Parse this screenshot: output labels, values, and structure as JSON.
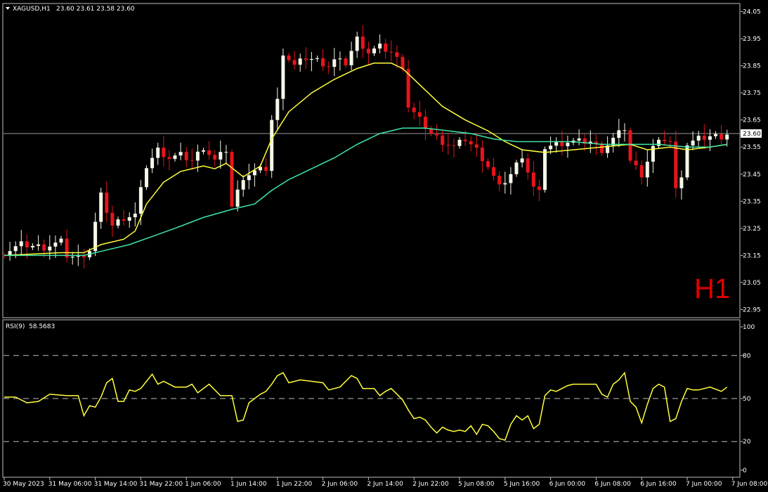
{
  "header": {
    "symbol_label": "XAGUSD,H1",
    "ohlc": "23.60 23.61 23.58 23.60"
  },
  "timeframe_badge": "H1",
  "rsi_header": {
    "label": "RSI(9)",
    "value": "58.5683"
  },
  "colors": {
    "background": "#000000",
    "frame": "#c0c0c0",
    "bull_candle": "#f4f8e8",
    "bear_candle": "#e8141c",
    "ma_fast": "#ffff3c",
    "ma_slow": "#3ee8a8",
    "rsi_line": "#ffff3c",
    "text": "#ffffff",
    "badge": "#e00000"
  },
  "chart_data": [
    {
      "type": "candlestick",
      "title": "XAGUSD,H1",
      "price_axis": {
        "range": [
          22.92,
          24.08
        ],
        "ticks": [
          "24.05",
          "23.95",
          "23.85",
          "23.75",
          "23.65",
          "23.55",
          "23.45",
          "23.35",
          "23.25",
          "23.15",
          "23.05",
          "22.95"
        ]
      },
      "current_price": "23.60",
      "time_axis": {
        "labels": [
          "30 May 2023",
          "31 May 06:00",
          "31 May 14:00",
          "31 May 22:00",
          "1 Jun 06:00",
          "1 Jun 14:00",
          "1 Jun 22:00",
          "2 Jun 06:00",
          "2 Jun 14:00",
          "2 Jun 22:00",
          "5 Jun 08:00",
          "5 Jun 16:00",
          "6 Jun 00:00",
          "6 Jun 08:00",
          "6 Jun 16:00",
          "7 Jun 00:00",
          "7 Jun 08:00"
        ],
        "bars_per_label": 8
      },
      "close_path": [
        [
          0,
          23.16
        ],
        [
          3,
          23.19
        ],
        [
          7,
          23.18
        ],
        [
          10,
          23.2
        ],
        [
          11,
          23.15
        ],
        [
          13,
          23.14
        ],
        [
          15,
          23.17
        ],
        [
          17,
          23.37
        ],
        [
          19,
          23.26
        ],
        [
          21,
          23.29
        ],
        [
          23,
          23.3
        ],
        [
          25,
          23.48
        ],
        [
          27,
          23.54
        ],
        [
          29,
          23.51
        ],
        [
          31,
          23.52
        ],
        [
          33,
          23.5
        ],
        [
          35,
          23.55
        ],
        [
          37,
          23.5
        ],
        [
          39,
          23.54
        ],
        [
          40,
          23.33
        ],
        [
          42,
          23.44
        ],
        [
          44,
          23.46
        ],
        [
          46,
          23.47
        ],
        [
          47,
          23.65
        ],
        [
          48,
          23.72
        ],
        [
          49,
          23.9
        ],
        [
          51,
          23.85
        ],
        [
          53,
          23.88
        ],
        [
          55,
          23.87
        ],
        [
          57,
          23.85
        ],
        [
          58,
          23.87
        ],
        [
          60,
          23.86
        ],
        [
          62,
          23.95
        ],
        [
          64,
          23.9
        ],
        [
          66,
          23.92
        ],
        [
          68,
          23.9
        ],
        [
          70,
          23.85
        ],
        [
          71,
          23.7
        ],
        [
          73,
          23.65
        ],
        [
          75,
          23.6
        ],
        [
          77,
          23.57
        ],
        [
          79,
          23.55
        ],
        [
          81,
          23.58
        ],
        [
          83,
          23.54
        ],
        [
          85,
          23.48
        ],
        [
          87,
          23.4
        ],
        [
          89,
          23.45
        ],
        [
          91,
          23.52
        ],
        [
          93,
          23.4
        ],
        [
          94,
          23.38
        ],
        [
          95,
          23.55
        ],
        [
          97,
          23.56
        ],
        [
          99,
          23.57
        ],
        [
          103,
          23.57
        ],
        [
          105,
          23.54
        ],
        [
          107,
          23.58
        ],
        [
          109,
          23.62
        ],
        [
          110,
          23.5
        ],
        [
          112,
          23.45
        ],
        [
          114,
          23.55
        ],
        [
          116,
          23.58
        ],
        [
          117,
          23.57
        ],
        [
          118,
          23.39
        ],
        [
          119,
          23.45
        ],
        [
          120,
          23.56
        ],
        [
          122,
          23.58
        ],
        [
          124,
          23.59
        ],
        [
          126,
          23.59
        ],
        [
          127,
          23.6
        ]
      ],
      "moving_averages": [
        {
          "name": "fast",
          "points": [
            [
              0,
              23.15
            ],
            [
              10,
              23.16
            ],
            [
              14,
              23.16
            ],
            [
              17,
              23.19
            ],
            [
              21,
              23.21
            ],
            [
              23,
              23.24
            ],
            [
              25,
              23.34
            ],
            [
              28,
              23.42
            ],
            [
              31,
              23.46
            ],
            [
              35,
              23.48
            ],
            [
              37,
              23.47
            ],
            [
              39,
              23.49
            ],
            [
              42,
              23.44
            ],
            [
              45,
              23.48
            ],
            [
              47,
              23.58
            ],
            [
              50,
              23.68
            ],
            [
              54,
              23.75
            ],
            [
              58,
              23.8
            ],
            [
              62,
              23.84
            ],
            [
              65,
              23.86
            ],
            [
              68,
              23.86
            ],
            [
              70,
              23.84
            ],
            [
              73,
              23.78
            ],
            [
              77,
              23.7
            ],
            [
              81,
              23.65
            ],
            [
              85,
              23.61
            ],
            [
              88,
              23.57
            ],
            [
              91,
              23.54
            ],
            [
              95,
              23.53
            ],
            [
              100,
              23.54
            ],
            [
              105,
              23.55
            ],
            [
              110,
              23.56
            ],
            [
              113,
              23.54
            ],
            [
              117,
              23.55
            ],
            [
              120,
              23.54
            ],
            [
              124,
              23.55
            ],
            [
              127,
              23.56
            ]
          ]
        },
        {
          "name": "slow",
          "points": [
            [
              0,
              23.15
            ],
            [
              10,
              23.15
            ],
            [
              14,
              23.15
            ],
            [
              18,
              23.17
            ],
            [
              22,
              23.19
            ],
            [
              26,
              23.22
            ],
            [
              30,
              23.25
            ],
            [
              35,
              23.29
            ],
            [
              40,
              23.32
            ],
            [
              44,
              23.34
            ],
            [
              47,
              23.39
            ],
            [
              50,
              23.43
            ],
            [
              54,
              23.47
            ],
            [
              58,
              23.51
            ],
            [
              62,
              23.56
            ],
            [
              66,
              23.6
            ],
            [
              70,
              23.62
            ],
            [
              74,
              23.62
            ],
            [
              78,
              23.61
            ],
            [
              82,
              23.6
            ],
            [
              86,
              23.58
            ],
            [
              90,
              23.57
            ],
            [
              95,
              23.57
            ],
            [
              100,
              23.57
            ],
            [
              105,
              23.56
            ],
            [
              110,
              23.56
            ],
            [
              115,
              23.56
            ],
            [
              120,
              23.55
            ],
            [
              124,
              23.55
            ],
            [
              127,
              23.56
            ]
          ]
        }
      ]
    },
    {
      "type": "line",
      "title": "RSI(9) 58.5683",
      "y_range": [
        0,
        100
      ],
      "y_ticks": [
        "100",
        "80",
        "50",
        "20",
        "0"
      ],
      "levels": [
        80,
        50,
        20
      ],
      "series": [
        {
          "name": "RSI(9)",
          "points": [
            [
              0,
              51
            ],
            [
              2,
              51
            ],
            [
              4,
              47
            ],
            [
              6,
              48
            ],
            [
              8,
              53
            ],
            [
              11,
              52
            ],
            [
              13,
              52
            ],
            [
              14,
              38
            ],
            [
              15,
              45
            ],
            [
              16,
              44
            ],
            [
              17,
              51
            ],
            [
              18,
              61
            ],
            [
              19,
              64
            ],
            [
              20,
              48
            ],
            [
              21,
              48
            ],
            [
              22,
              56
            ],
            [
              23,
              55
            ],
            [
              24,
              57
            ],
            [
              25,
              62
            ],
            [
              26,
              67
            ],
            [
              27,
              60
            ],
            [
              28,
              62
            ],
            [
              29,
              60
            ],
            [
              30,
              58
            ],
            [
              32,
              58
            ],
            [
              33,
              60
            ],
            [
              34,
              54
            ],
            [
              36,
              60
            ],
            [
              38,
              52
            ],
            [
              40,
              52
            ],
            [
              41,
              34
            ],
            [
              42,
              35
            ],
            [
              43,
              47
            ],
            [
              45,
              53
            ],
            [
              46,
              55
            ],
            [
              47,
              60
            ],
            [
              48,
              66
            ],
            [
              49,
              68
            ],
            [
              50,
              61
            ],
            [
              52,
              63
            ],
            [
              54,
              62
            ],
            [
              56,
              61
            ],
            [
              57,
              56
            ],
            [
              59,
              58
            ],
            [
              61,
              66
            ],
            [
              62,
              64
            ],
            [
              63,
              57
            ],
            [
              65,
              57
            ],
            [
              66,
              52
            ],
            [
              67,
              55
            ],
            [
              68,
              57
            ],
            [
              70,
              49
            ],
            [
              71,
              42
            ],
            [
              72,
              36
            ],
            [
              73,
              37
            ],
            [
              74,
              35
            ],
            [
              75,
              30
            ],
            [
              76,
              26
            ],
            [
              77,
              30
            ],
            [
              78,
              28
            ],
            [
              79,
              27
            ],
            [
              80,
              28
            ],
            [
              81,
              27
            ],
            [
              82,
              31
            ],
            [
              83,
              25
            ],
            [
              84,
              32
            ],
            [
              85,
              31
            ],
            [
              86,
              27
            ],
            [
              87,
              22
            ],
            [
              88,
              21
            ],
            [
              89,
              32
            ],
            [
              90,
              38
            ],
            [
              91,
              35
            ],
            [
              92,
              38
            ],
            [
              93,
              29
            ],
            [
              94,
              32
            ],
            [
              95,
              52
            ],
            [
              96,
              56
            ],
            [
              97,
              55
            ],
            [
              98,
              57
            ],
            [
              99,
              59
            ],
            [
              100,
              60
            ],
            [
              104,
              60
            ],
            [
              105,
              53
            ],
            [
              106,
              51
            ],
            [
              107,
              60
            ],
            [
              108,
              63
            ],
            [
              109,
              68
            ],
            [
              110,
              48
            ],
            [
              111,
              44
            ],
            [
              112,
              33
            ],
            [
              113,
              46
            ],
            [
              114,
              57
            ],
            [
              115,
              60
            ],
            [
              116,
              58
            ],
            [
              117,
              34
            ],
            [
              118,
              36
            ],
            [
              119,
              48
            ],
            [
              120,
              57
            ],
            [
              121,
              56
            ],
            [
              122,
              56
            ],
            [
              124,
              58
            ],
            [
              126,
              55
            ],
            [
              127,
              58
            ]
          ]
        }
      ]
    }
  ]
}
